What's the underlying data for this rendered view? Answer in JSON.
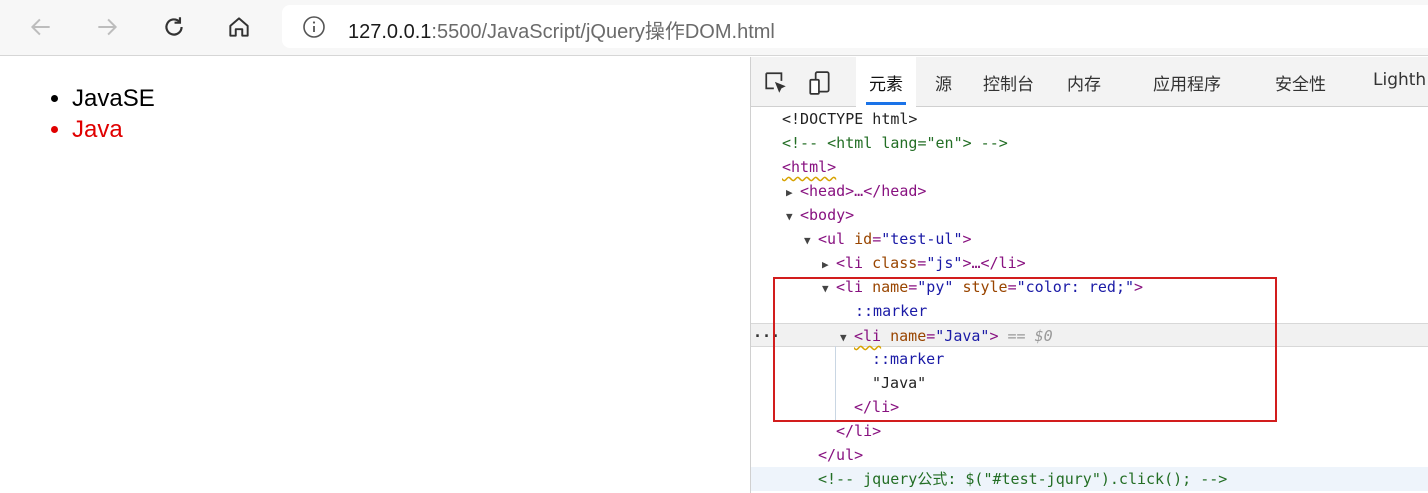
{
  "browser": {
    "back_icon": "arrow-left-icon",
    "forward_icon": "arrow-right-icon",
    "reload_icon": "reload-icon",
    "home_icon": "home-icon",
    "address": {
      "host": "127.0.0.1",
      "rest": ":5500/JavaScript/jQuery操作DOM.html"
    }
  },
  "page": {
    "items": [
      {
        "text": "JavaSE",
        "color": "#000000"
      },
      {
        "text": "Java",
        "color": "#e00000"
      }
    ]
  },
  "devtools": {
    "tabs": [
      "元素",
      "源",
      "控制台",
      "内存",
      "应用程序",
      "安全性",
      "Lighth"
    ],
    "active_tab": "元素",
    "accent": "#1a73e8",
    "lines": {
      "doctype": "<!DOCTYPE html>",
      "comment_html": "<!-- <html lang=\"en\"> -->",
      "html_open": "<html>",
      "head": "<head>…</head>",
      "body_open": "<body>",
      "ul_tag": "<ul",
      "ul_attr_name": "id",
      "ul_attr_val": "\"test-ul\"",
      "li_js_tag": "<li",
      "li_js_attr": "class",
      "li_js_val": "\"js\"",
      "li_js_rest": ">…</li>",
      "li_py_tag": "<li",
      "li_py_name": "name",
      "li_py_nameval": "\"py\"",
      "li_py_style": "style",
      "li_py_styleval": "\"color: red;\"",
      "marker": "::marker",
      "li_java_tag": "<li",
      "li_java_name": "name",
      "li_java_nameval": "\"Java\"",
      "selected_hint": "== $0",
      "text_java": "\"Java\"",
      "li_close": "</li>",
      "ul_close": "</ul>",
      "comment_jq": "<!-- jquery公式: $(\"#test-jqury\").click(); -->"
    }
  },
  "highlight_color": "#d21d1d"
}
